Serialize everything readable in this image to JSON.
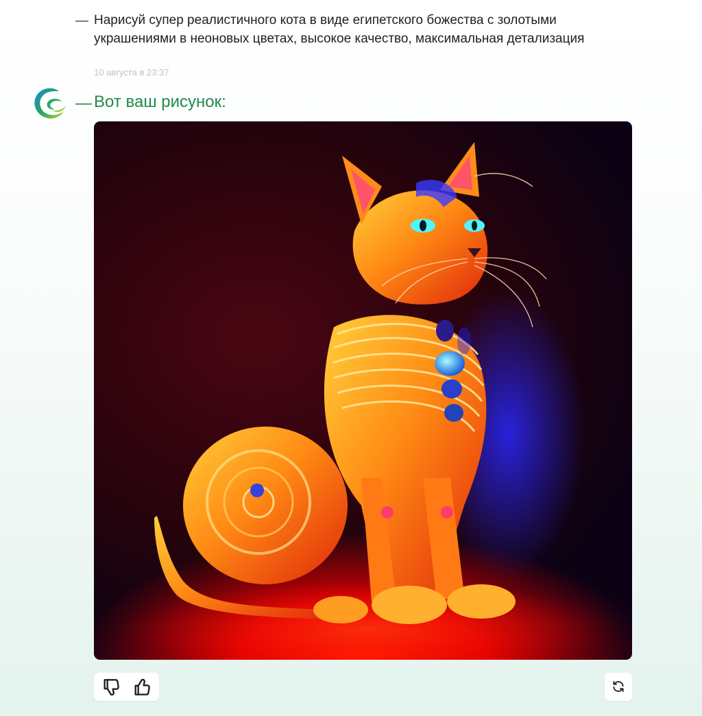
{
  "conversation": {
    "user_message": {
      "dash": "—",
      "text": "Нарисуй супер реалистичного кота в виде египетского божества с золотыми украшениями в неоновых цветах, высокое качество, максимальная детализация",
      "timestamp": "10 августа в 23:37"
    },
    "bot_message": {
      "dash": "—",
      "text": "Вот ваш рисунок:",
      "avatar_icon": "assistant-logo-icon",
      "image_icon": "generated-image-egyptian-cat"
    }
  },
  "actions": {
    "dislike_icon": "thumbs-down-icon",
    "like_icon": "thumbs-up-icon",
    "regenerate_icon": "refresh-icon"
  },
  "colors": {
    "accent_green": "#1f8a4c",
    "text_primary": "#1f1f1f",
    "timestamp": "#c2c2c2"
  }
}
